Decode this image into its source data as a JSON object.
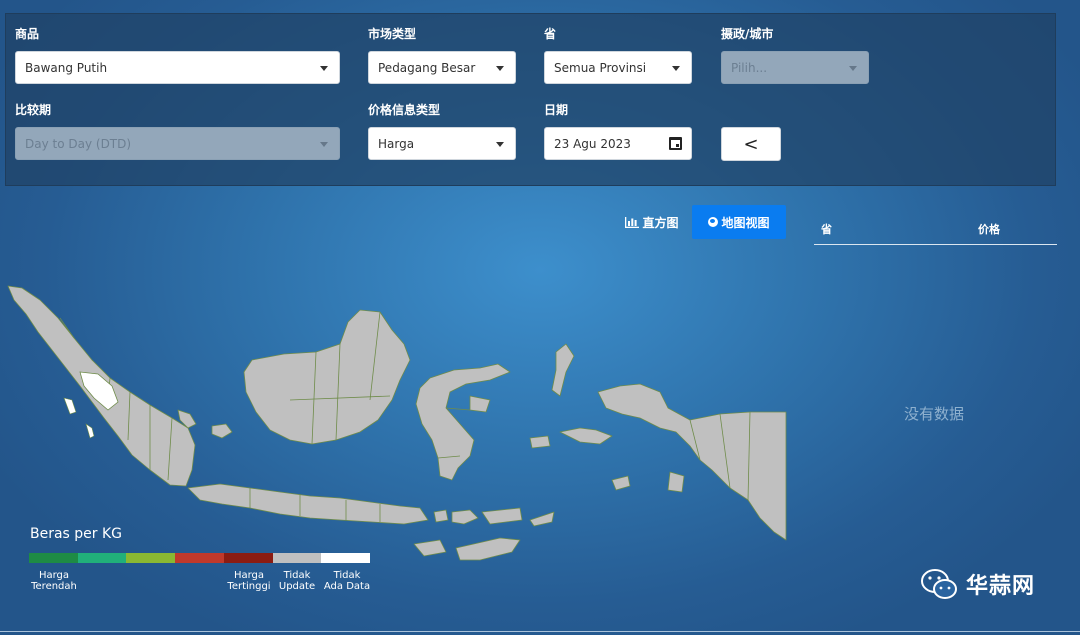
{
  "filters": {
    "commodity": {
      "label": "商品",
      "value": "Bawang Putih"
    },
    "market_type": {
      "label": "市场类型",
      "value": "Pedagang Besar"
    },
    "province": {
      "label": "省",
      "value": "Semua Provinsi"
    },
    "regency": {
      "label": "摄政/城市",
      "placeholder": "Pilih..."
    },
    "compare_period": {
      "label": "比较期",
      "value": "Day to Day (DTD)"
    },
    "price_info_type": {
      "label": "价格信息类型",
      "value": "Harga"
    },
    "date": {
      "label": "日期",
      "value": "23 Agu 2023"
    },
    "back_button": "<"
  },
  "view_toggle": {
    "histogram_label": "直方图",
    "map_label": "地图视图",
    "active": "map"
  },
  "table": {
    "col_province": "省",
    "col_price": "价格",
    "empty_text": "没有数据"
  },
  "legend": {
    "title": "Beras per KG",
    "colors": [
      "#1e8b45",
      "#21b07a",
      "#8ab832",
      "#c0392b",
      "#8b1c12",
      "#c0c0c0",
      "#ffffff"
    ],
    "label_lowest": [
      "Harga",
      "Terendah"
    ],
    "label_highest": [
      "Harga",
      "Tertinggi"
    ],
    "label_not_updated": [
      "Tidak",
      "Update"
    ],
    "label_no_data": [
      "Tidak",
      "Ada Data"
    ]
  },
  "map": {
    "default_fill": "#c0c0c0",
    "highlight_fill": "#ffffff",
    "border_color": "#6f8c4a"
  },
  "watermark": "华蒜网"
}
